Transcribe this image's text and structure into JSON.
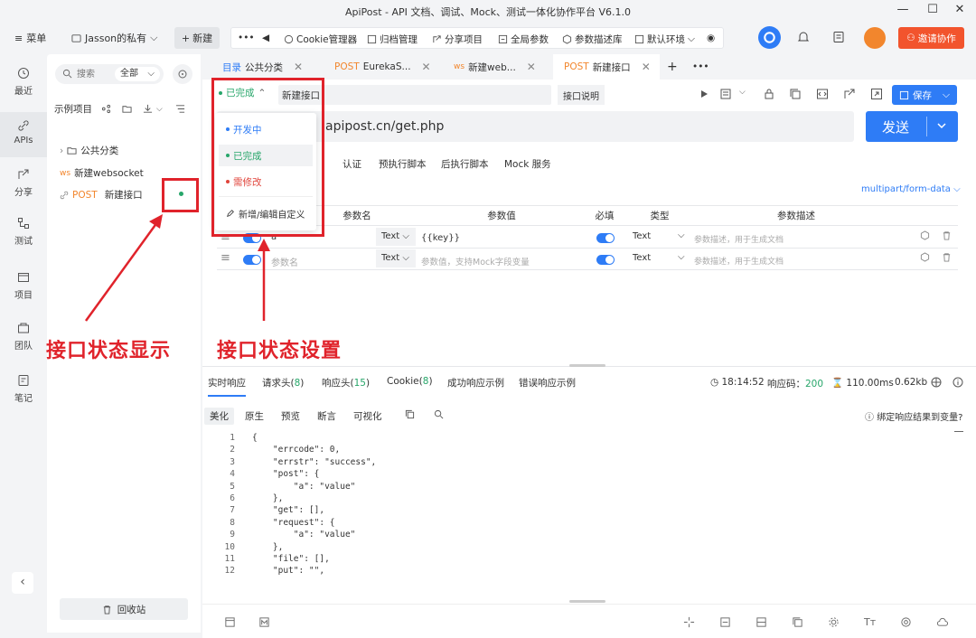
{
  "window": {
    "title": "ApiPost - API 文档、调试、Mock、测试一体化协作平台 V6.1.0"
  },
  "menubar": {
    "menu_label": "菜单",
    "workspace": "Jasson的私有",
    "new_label": "新建",
    "toolbar_items": [
      "Cookie管理器",
      "归档管理",
      "分享项目",
      "全局参数",
      "参数描述库",
      "默认环境"
    ],
    "invite_label": "邀请协作"
  },
  "rail": {
    "items": [
      "最近",
      "APIs",
      "分享",
      "测试",
      "项目",
      "团队",
      "笔记"
    ]
  },
  "panel": {
    "search_placeholder": "搜索",
    "filter_value": "全部",
    "project_name": "示例项目",
    "tree": {
      "folder": "公共分类",
      "ws_tag": "ws",
      "ws_name": "新建websocket",
      "post_tag": "POST",
      "post_name": "新建接口"
    },
    "trash_label": "回收站"
  },
  "tabs": [
    {
      "prefix": "目录",
      "name": "公共分类"
    },
    {
      "prefix": "POST",
      "name": "EurekaS..."
    },
    {
      "prefix": "ws",
      "name": "新建web..."
    },
    {
      "prefix": "POST",
      "name": "新建接口"
    }
  ],
  "request": {
    "status_current": "已完成",
    "api_name": "新建接口",
    "desc_button": "接口说明",
    "save_label": "保存",
    "url": "apipost.cn/get.php",
    "send_label": "发送",
    "subtabs": [
      "认证",
      "预执行脚本",
      "后执行脚本",
      "Mock 服务"
    ],
    "body_format": "multipart/form-data",
    "param_headers": [
      "参数名",
      "参数值",
      "必填",
      "类型",
      "参数描述"
    ],
    "params": [
      {
        "name": "a",
        "value": "{{key}}",
        "field_type": "Text",
        "type": "Text",
        "desc_placeholder": "参数描述，用于生成文档"
      },
      {
        "name_placeholder": "参数名",
        "value_placeholder": "参数值，支持Mock字段变量",
        "field_type": "Text",
        "type": "Text",
        "desc_placeholder": "参数描述，用于生成文档"
      }
    ]
  },
  "status_popup": {
    "items": [
      {
        "label": "开发中",
        "color": "#2e7cf6"
      },
      {
        "label": "已完成",
        "color": "#27a66a"
      },
      {
        "label": "需修改",
        "color": "#e0443b"
      }
    ],
    "edit_label": "新增/编辑自定义"
  },
  "response": {
    "tabs": [
      "实时响应",
      "请求头",
      "8",
      "响应头",
      "15",
      "Cookie",
      "8",
      "成功响应示例",
      "错误响应示例"
    ],
    "time": "18:14:52",
    "code_label": "响应码：",
    "code": "200",
    "duration": "110.00ms",
    "size": "0.62kb",
    "view_tabs": [
      "美化",
      "原生",
      "预览",
      "断言",
      "可视化"
    ],
    "bind_label": "绑定响应结果到变量?",
    "code_lines": [
      "{",
      "    \"errcode\": 0,",
      "    \"errstr\": \"success\",",
      "    \"post\": {",
      "        \"a\": \"value\"",
      "    },",
      "    \"get\": [],",
      "    \"request\": {",
      "        \"a\": \"value\"",
      "    },",
      "    \"file\": [],",
      "    \"put\": \"\","
    ]
  },
  "annotations": {
    "left_label": "接口状态显示",
    "right_label": "接口状态设置"
  },
  "colors": {
    "accent": "#2e7cf6",
    "invite": "#f2542d",
    "annotation": "#e0232b",
    "status_done": "#27a66a"
  }
}
